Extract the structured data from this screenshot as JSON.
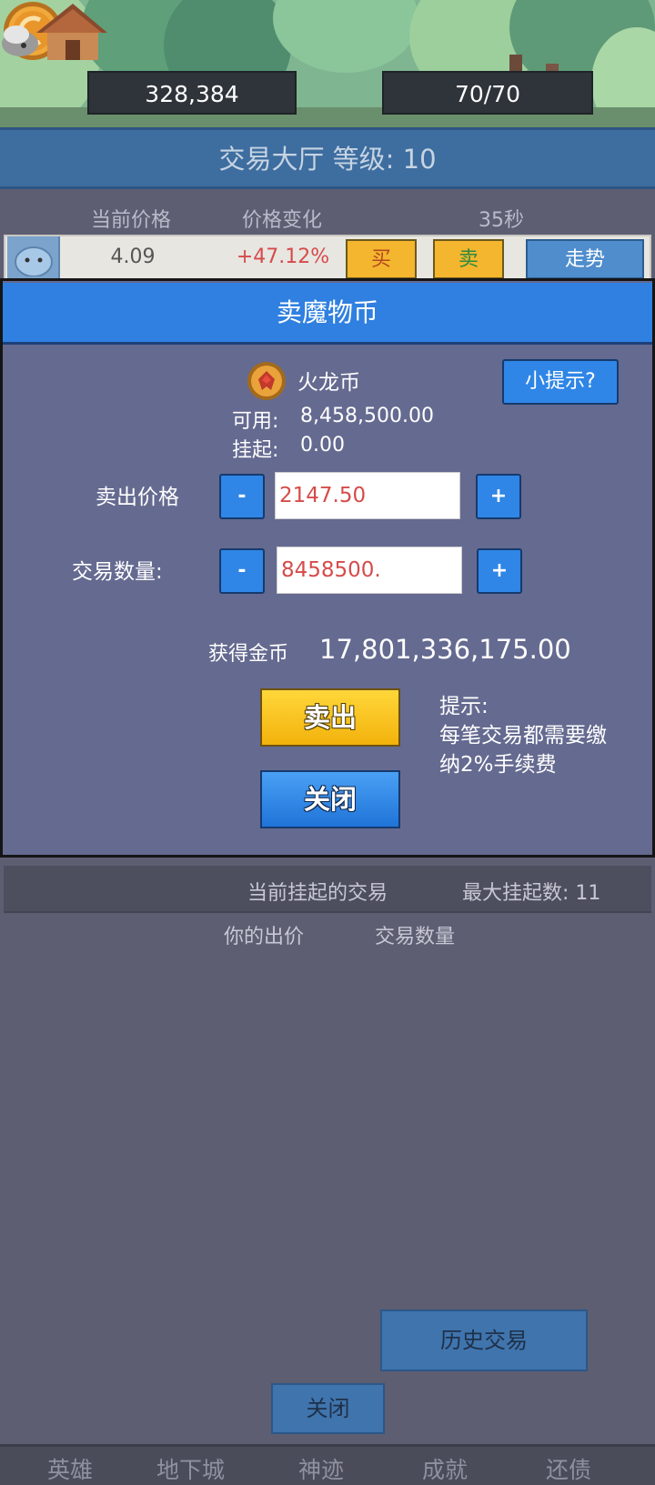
{
  "header": {
    "gold": "328,384",
    "population": "70/70"
  },
  "hall": {
    "title": "交易大厅 等级: 10",
    "col_price": "当前价格",
    "col_change": "价格变化",
    "timer": "35秒",
    "row": {
      "price": "4.09",
      "change": "+47.12%",
      "buy_label": "买",
      "sell_label": "卖",
      "trend_label": "走势"
    },
    "pending_title": "当前挂起的交易",
    "max_pending": "最大挂起数: 11",
    "col_your_bid": "你的出价",
    "col_quantity": "交易数量",
    "history_label": "历史交易",
    "close_label": "关闭"
  },
  "nav": {
    "items": [
      "英雄",
      "地下城",
      "神迹",
      "成就",
      "还债"
    ]
  },
  "modal": {
    "title": "卖魔物币",
    "coin_name": "火龙币",
    "hint_label": "小提示?",
    "available_label": "可用:",
    "available_value": "8,458,500.00",
    "pending_label": "挂起:",
    "pending_value": "0.00",
    "price_label": "卖出价格",
    "price_value": "2147.50",
    "qty_label": "交易数量:",
    "qty_value": "8458500.",
    "minus": "-",
    "plus": "+",
    "gain_label": "获得金币",
    "gain_value": "17,801,336,175.00",
    "sell_label": "卖出",
    "close_label": "关闭",
    "tip_title": "提示:",
    "tip_line1": "每笔交易都需要缴",
    "tip_line2": "纳2%手续费"
  }
}
